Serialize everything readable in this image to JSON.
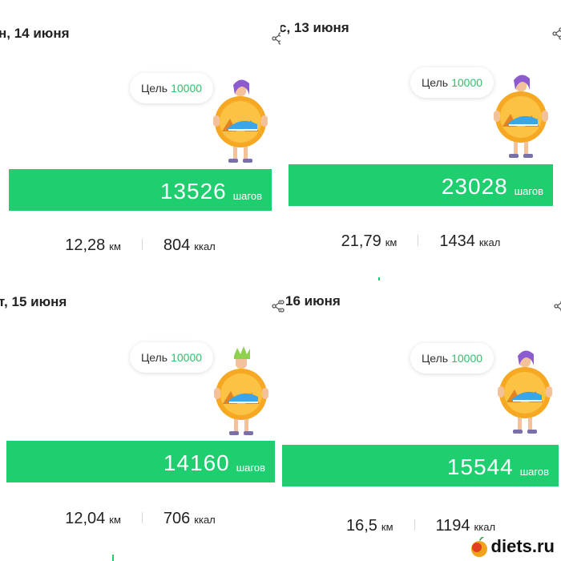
{
  "panels": [
    {
      "date": "н, 14 июня",
      "goal_label": "Цель",
      "goal_value": "10000",
      "steps": "13526",
      "steps_unit": "шагов",
      "distance": "12,28",
      "distance_unit": "км",
      "calories": "804",
      "calories_unit": "ккал"
    },
    {
      "date": "с, 13 июня",
      "goal_label": "Цель",
      "goal_value": "10000",
      "steps": "23028",
      "steps_unit": "шагов",
      "distance": "21,79",
      "distance_unit": "км",
      "calories": "1434",
      "calories_unit": "ккал"
    },
    {
      "date": "т, 15 июня",
      "goal_label": "Цель",
      "goal_value": "10000",
      "steps": "14160",
      "steps_unit": "шагов",
      "distance": "12,04",
      "distance_unit": "км",
      "calories": "706",
      "calories_unit": "ккал"
    },
    {
      "date": "16 июня",
      "goal_label": "Цель",
      "goal_value": "10000",
      "steps": "15544",
      "steps_unit": "шагов",
      "distance": "16,5",
      "distance_unit": "км",
      "calories": "1194",
      "calories_unit": "ккал"
    }
  ],
  "watermark": {
    "text": "diets.ru",
    "icon": "apple-icon"
  },
  "colors": {
    "accent": "#1fcf6f",
    "goal_text": "#2dbf6a",
    "mascot_hair_purple": "#8c5bd0",
    "mascot_hair_green": "#8fd14f",
    "sun": "#f6a823"
  }
}
